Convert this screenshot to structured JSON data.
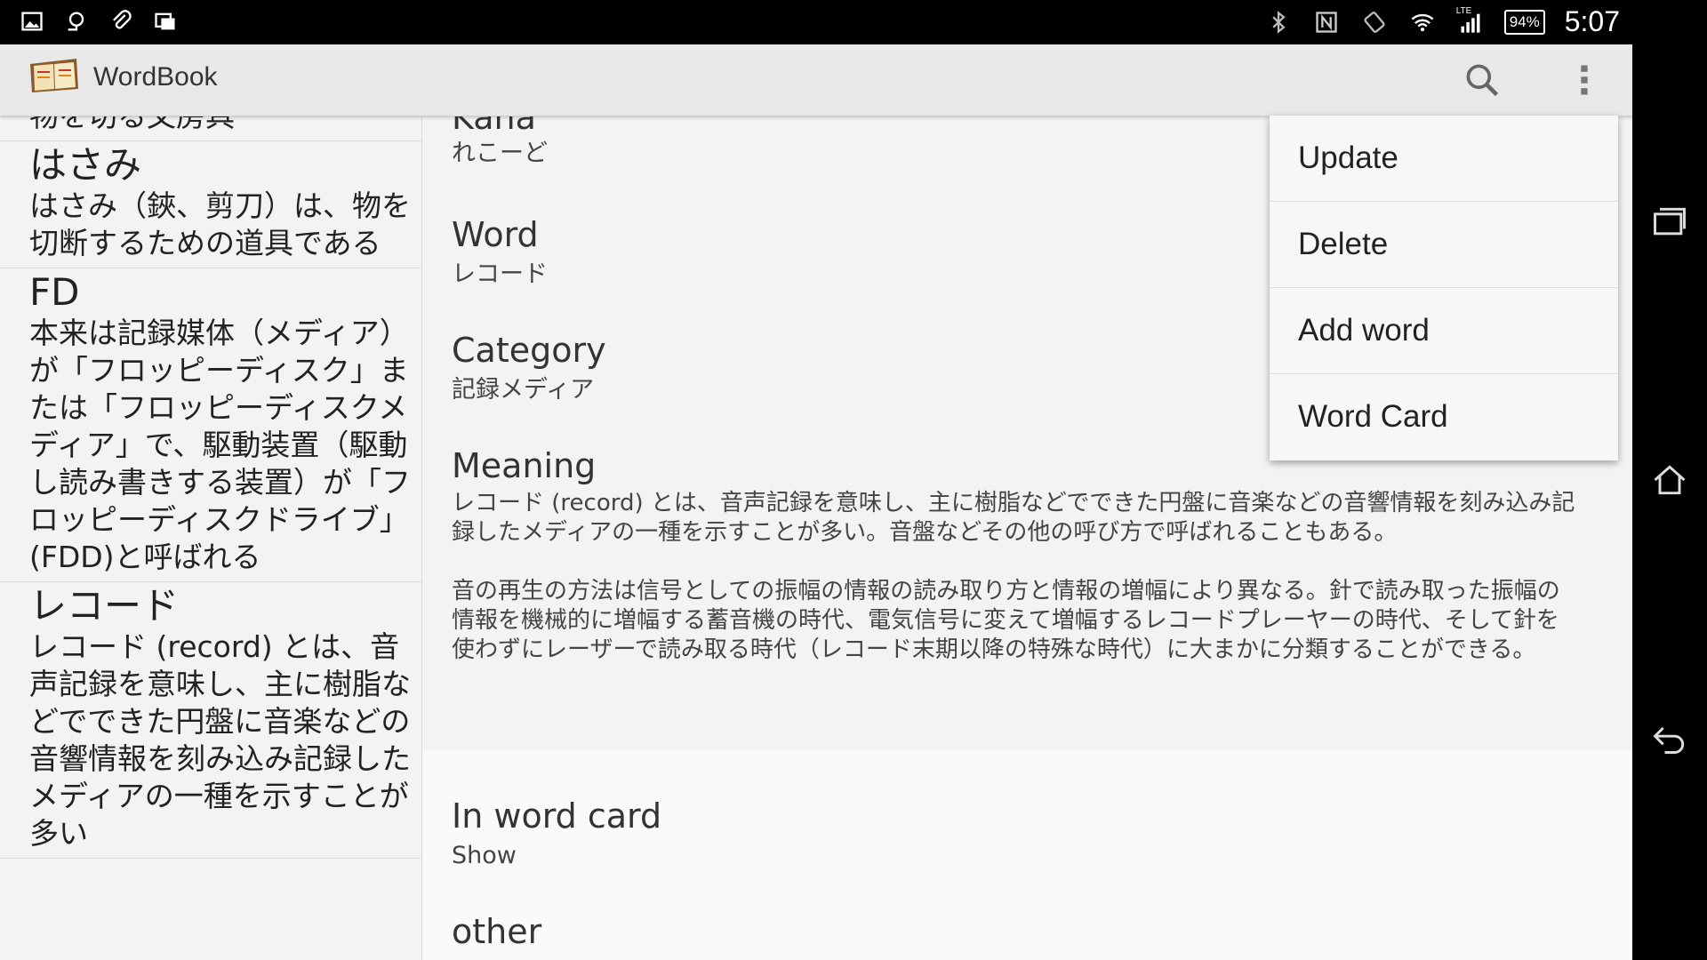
{
  "status": {
    "battery": "94%",
    "time": "5:07",
    "lte": "LTE"
  },
  "app": {
    "title": "WordBook"
  },
  "list": [
    {
      "word": "",
      "meaning": "物を切る文房具"
    },
    {
      "word": "はさみ",
      "meaning": "はさみ（鋏、剪刀）は、物を切断するための道具である"
    },
    {
      "word": "FD",
      "meaning": "本来は記録媒体（メディア）が「フロッピーディスク」または「フロッピーディスクメディア」で、駆動装置（駆動し読み書きする装置）が「フロッピーディスクドライブ」(FDD)と呼ばれる"
    },
    {
      "word": "レコード",
      "meaning": "レコード (record) とは、音声記録を意味し、主に樹脂などでできた円盤に音楽などの音響情報を刻み込み記録したメディアの一種を示すことが多い"
    }
  ],
  "detail": {
    "kana_label": "Kana",
    "kana_value": "れこーど",
    "word_label": "Word",
    "word_value": "レコード",
    "category_label": "Category",
    "category_value": "記録メディア",
    "meaning_label": "Meaning",
    "meaning_value": "レコード (record) とは、音声記録を意味し、主に樹脂などでできた円盤に音楽などの音響情報を刻み込み記録したメディアの一種を示すことが多い。音盤などその他の呼び方で呼ばれることもある。\n\n音の再生の方法は信号としての振幅の情報の読み取り方と情報の増幅により異なる。針で読み取った振幅の情報を機械的に増幅する蓄音機の時代、電気信号に変えて増幅するレコードプレーヤーの時代、そして針を使わずにレーザーで読み取る時代（レコード末期以降の特殊な時代）に大まかに分類することができる。",
    "wordcard_label": "In word card",
    "wordcard_value": "Show",
    "other_label": "other"
  },
  "menu": {
    "update": "Update",
    "delete": "Delete",
    "add_word": "Add word",
    "word_card": "Word Card"
  }
}
